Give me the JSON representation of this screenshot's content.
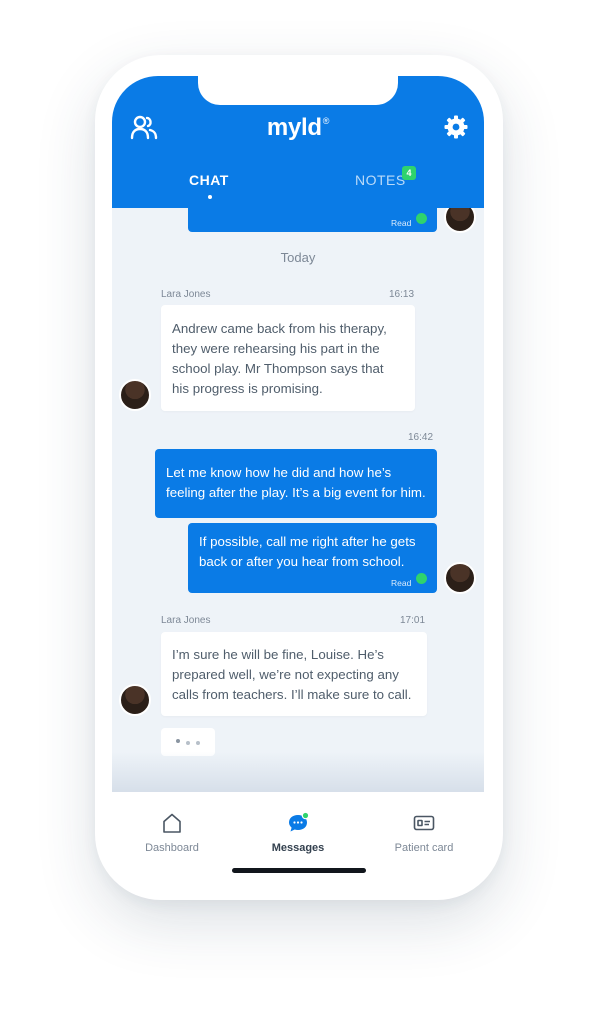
{
  "app": {
    "logo": "myld",
    "logo_mark": "®"
  },
  "tabs": [
    {
      "label": "CHAT",
      "active": true
    },
    {
      "label": "NOTES",
      "badge": "4",
      "active": false
    }
  ],
  "chat": {
    "date_separator": "Today",
    "read_label": "Read",
    "messages": [
      {
        "direction": "outgoing",
        "partial": true,
        "status": "Read"
      },
      {
        "direction": "incoming",
        "sender": "Lara Jones",
        "time": "16:13",
        "lines": [
          "Andrew came back from his therapy,",
          "they were rehearsing his part in the",
          "school play. Mr Thompson says that",
          "his progress is promising."
        ]
      },
      {
        "direction": "outgoing",
        "time": "16:42",
        "lines": [
          "Let me know how he did and how he’s",
          "feeling after the play. It’s a big event for him."
        ]
      },
      {
        "direction": "outgoing",
        "status": "Read",
        "lines": [
          "If possible, call me right after he gets",
          "back or after you hear from school."
        ]
      },
      {
        "direction": "incoming",
        "sender": "Lara Jones",
        "time": "17:01",
        "lines": [
          "I’m sure he will be fine, Louise. He’s",
          "prepared well, we’re not expecting any",
          "calls from teachers. I’ll make sure to call."
        ]
      }
    ],
    "typing_indicator": true
  },
  "bottom_nav": [
    {
      "label": "Dashboard",
      "icon": "home-icon",
      "active": false
    },
    {
      "label": "Messages",
      "icon": "messages-icon",
      "active": true,
      "has_notification": true
    },
    {
      "label": "Patient card",
      "icon": "id-card-icon",
      "active": false
    }
  ],
  "colors": {
    "primary": "#0a7be6",
    "accent_green": "#2fd36d",
    "chat_bg": "#eef3f8"
  }
}
